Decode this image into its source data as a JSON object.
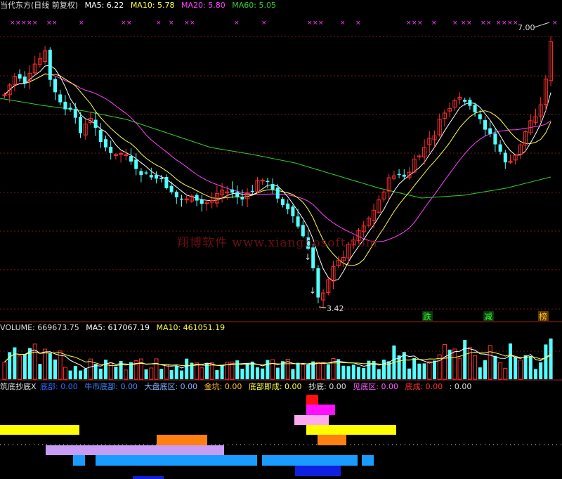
{
  "header": {
    "title": "当代东方(日线 前复权)",
    "ma5": "MA5: 6.22",
    "ma10": "MA10: 5.78",
    "ma20": "MA20: 5.80",
    "ma60": "MA60: 5.05"
  },
  "price_panel": {
    "high_label": "7.00",
    "low_label": "3.42",
    "tags": [
      "跌",
      "减",
      "榜"
    ],
    "watermark": "翔博软件 www.xiangbosoft.com"
  },
  "volume_panel": {
    "volume": "VOLUME: 669673.75",
    "ma5": "MA5: 617067.19",
    "ma10": "MA10: 461051.19"
  },
  "indicator_panel": {
    "name": "筑底抄底X",
    "items": [
      {
        "label": "底部: 0.00",
        "color": "#2c6dff"
      },
      {
        "label": "牛市底部: 0.00",
        "color": "#3a8dff"
      },
      {
        "label": "大盘底区: 0.00",
        "color": "#7fb0ff"
      },
      {
        "label": "金坑: 0.00",
        "color": "#ffc020"
      },
      {
        "label": "底部即成: 0.00",
        "color": "#ffff40"
      },
      {
        "label": "抄底: 0.00",
        "color": "#dddddd"
      },
      {
        "label": "见底区: 0.00",
        "color": "#ff5cff"
      },
      {
        "label": "底成: 0.00",
        "color": "#ff2f2f"
      },
      {
        "label": ": 0.00",
        "color": "#dddddd"
      }
    ]
  },
  "chart_data": {
    "type": "candlestick",
    "note_series": [
      "MA5",
      "MA10",
      "MA20",
      "MA60"
    ],
    "y_min_visible": 3.42,
    "y_max_visible": 7.0,
    "volume_unit": "lots"
  },
  "colors": {
    "bg": "#000000",
    "up": "#ff3030",
    "down": "#54ffff",
    "ma5": "#ffffff",
    "ma10": "#ffff40",
    "ma20": "#ff40ff",
    "ma60": "#30d030",
    "grid": "#8a1b1b"
  }
}
